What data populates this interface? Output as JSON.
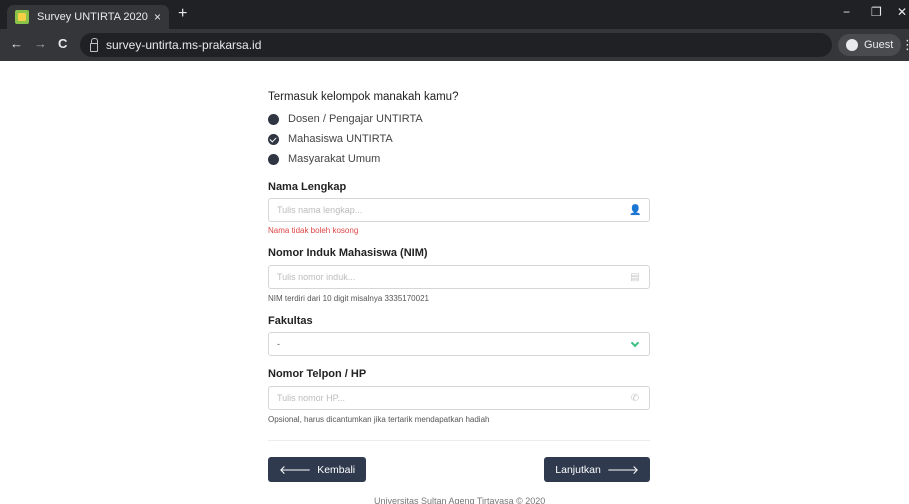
{
  "browser": {
    "tab_title": "Survey UNTIRTA 2020",
    "tab_close": "×",
    "new_tab": "+",
    "url": "survey-untirta.ms-prakarsa.id",
    "profile_label": "Guest",
    "minimize": "−",
    "restore": "❐",
    "close": "✕",
    "back": "←",
    "forward": "→",
    "reload": "C",
    "menu": "⋮"
  },
  "form": {
    "question": "Termasuk kelompok manakah kamu?",
    "options": [
      {
        "label": "Dosen / Pengajar UNTIRTA",
        "checked": false
      },
      {
        "label": "Mahasiswa UNTIRTA",
        "checked": true
      },
      {
        "label": "Masyarakat Umum",
        "checked": false
      }
    ],
    "nama": {
      "label": "Nama Lengkap",
      "placeholder": "Tulis nama lengkap...",
      "value": "",
      "error": "Nama tidak boleh kosong"
    },
    "nim": {
      "label": "Nomor Induk Mahasiswa (NIM)",
      "placeholder": "Tulis nomor induk...",
      "value": "",
      "help": "NIM terdiri dari 10 digit misalnya 3335170021"
    },
    "fakultas": {
      "label": "Fakultas",
      "selected": "-"
    },
    "telpon": {
      "label": "Nomor Telpon / HP",
      "placeholder": "Tulis nomor HP...",
      "value": "",
      "help": "Opsional, harus dicantumkan jika tertarik mendapatkan hadiah"
    },
    "back_label": "Kembali",
    "next_label": "Lanjutkan"
  },
  "footer": {
    "text": "Universitas Sultan Ageng Tirtayasa © 2020"
  }
}
